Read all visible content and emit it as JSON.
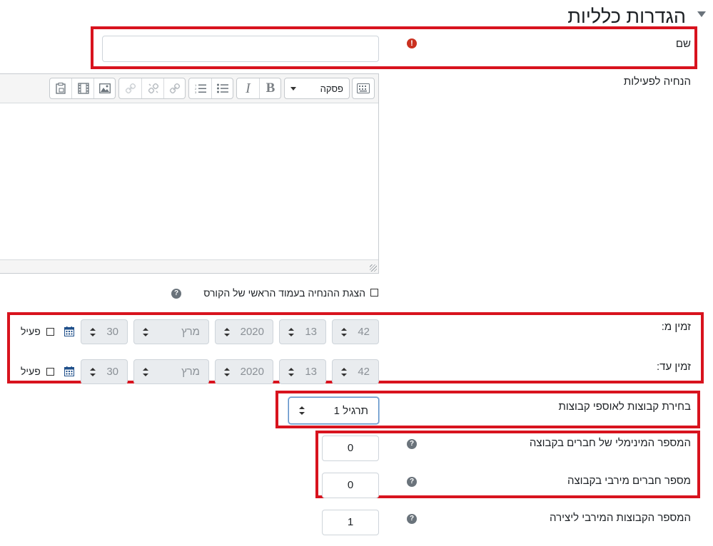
{
  "section": {
    "title": "הגדרות כלליות"
  },
  "name_field": {
    "label": "שם",
    "value": "",
    "error_icon": "!"
  },
  "description": {
    "label": "הנחיה לפעילות",
    "paragraph_select": "פסקה",
    "show_on_course_page_label": "הצגת ההנחיה בעמוד הראשי של הקורס"
  },
  "time_from": {
    "label": "זמין מ:",
    "day": "30",
    "month": "מרץ",
    "year": "2020",
    "hour": "13",
    "minute": "42",
    "enable_label": "פעיל"
  },
  "time_to": {
    "label": "זמין עד:",
    "day": "30",
    "month": "מרץ",
    "year": "2020",
    "hour": "13",
    "minute": "42",
    "enable_label": "פעיל"
  },
  "grouping": {
    "label": "בחירת קבוצות לאוספי קבוצות",
    "selected": "תרגיל 1"
  },
  "min_members": {
    "label": "המספר המינימלי של חברים בקבוצה",
    "value": "0"
  },
  "max_members": {
    "label": "מספר חברים מירבי בקבוצה",
    "value": "0"
  },
  "max_groups": {
    "label": "המספר הקבוצות המירבי ליצירה",
    "value": "1"
  },
  "colors": {
    "highlight": "#d8131e",
    "error": "#ca3120",
    "help": "#6a737b",
    "disabled_bg": "#e9ecef"
  }
}
